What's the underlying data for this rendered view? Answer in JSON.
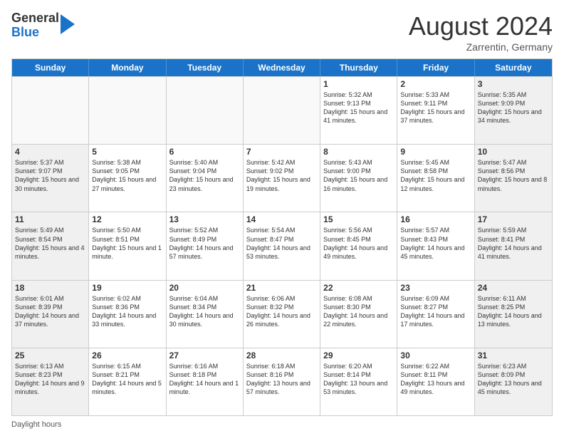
{
  "header": {
    "logo_general": "General",
    "logo_blue": "Blue",
    "month_title": "August 2024",
    "location": "Zarrentin, Germany"
  },
  "footer": {
    "daylight_label": "Daylight hours"
  },
  "days_of_week": [
    "Sunday",
    "Monday",
    "Tuesday",
    "Wednesday",
    "Thursday",
    "Friday",
    "Saturday"
  ],
  "rows": [
    [
      {
        "day": "",
        "text": "",
        "empty": true
      },
      {
        "day": "",
        "text": "",
        "empty": true
      },
      {
        "day": "",
        "text": "",
        "empty": true
      },
      {
        "day": "",
        "text": "",
        "empty": true
      },
      {
        "day": "1",
        "text": "Sunrise: 5:32 AM\nSunset: 9:13 PM\nDaylight: 15 hours\nand 41 minutes."
      },
      {
        "day": "2",
        "text": "Sunrise: 5:33 AM\nSunset: 9:11 PM\nDaylight: 15 hours\nand 37 minutes."
      },
      {
        "day": "3",
        "text": "Sunrise: 5:35 AM\nSunset: 9:09 PM\nDaylight: 15 hours\nand 34 minutes.",
        "shaded": true
      }
    ],
    [
      {
        "day": "4",
        "text": "Sunrise: 5:37 AM\nSunset: 9:07 PM\nDaylight: 15 hours\nand 30 minutes.",
        "shaded": true
      },
      {
        "day": "5",
        "text": "Sunrise: 5:38 AM\nSunset: 9:05 PM\nDaylight: 15 hours\nand 27 minutes."
      },
      {
        "day": "6",
        "text": "Sunrise: 5:40 AM\nSunset: 9:04 PM\nDaylight: 15 hours\nand 23 minutes."
      },
      {
        "day": "7",
        "text": "Sunrise: 5:42 AM\nSunset: 9:02 PM\nDaylight: 15 hours\nand 19 minutes."
      },
      {
        "day": "8",
        "text": "Sunrise: 5:43 AM\nSunset: 9:00 PM\nDaylight: 15 hours\nand 16 minutes."
      },
      {
        "day": "9",
        "text": "Sunrise: 5:45 AM\nSunset: 8:58 PM\nDaylight: 15 hours\nand 12 minutes."
      },
      {
        "day": "10",
        "text": "Sunrise: 5:47 AM\nSunset: 8:56 PM\nDaylight: 15 hours\nand 8 minutes.",
        "shaded": true
      }
    ],
    [
      {
        "day": "11",
        "text": "Sunrise: 5:49 AM\nSunset: 8:54 PM\nDaylight: 15 hours\nand 4 minutes.",
        "shaded": true
      },
      {
        "day": "12",
        "text": "Sunrise: 5:50 AM\nSunset: 8:51 PM\nDaylight: 15 hours\nand 1 minute."
      },
      {
        "day": "13",
        "text": "Sunrise: 5:52 AM\nSunset: 8:49 PM\nDaylight: 14 hours\nand 57 minutes."
      },
      {
        "day": "14",
        "text": "Sunrise: 5:54 AM\nSunset: 8:47 PM\nDaylight: 14 hours\nand 53 minutes."
      },
      {
        "day": "15",
        "text": "Sunrise: 5:56 AM\nSunset: 8:45 PM\nDaylight: 14 hours\nand 49 minutes."
      },
      {
        "day": "16",
        "text": "Sunrise: 5:57 AM\nSunset: 8:43 PM\nDaylight: 14 hours\nand 45 minutes."
      },
      {
        "day": "17",
        "text": "Sunrise: 5:59 AM\nSunset: 8:41 PM\nDaylight: 14 hours\nand 41 minutes.",
        "shaded": true
      }
    ],
    [
      {
        "day": "18",
        "text": "Sunrise: 6:01 AM\nSunset: 8:39 PM\nDaylight: 14 hours\nand 37 minutes.",
        "shaded": true
      },
      {
        "day": "19",
        "text": "Sunrise: 6:02 AM\nSunset: 8:36 PM\nDaylight: 14 hours\nand 33 minutes."
      },
      {
        "day": "20",
        "text": "Sunrise: 6:04 AM\nSunset: 8:34 PM\nDaylight: 14 hours\nand 30 minutes."
      },
      {
        "day": "21",
        "text": "Sunrise: 6:06 AM\nSunset: 8:32 PM\nDaylight: 14 hours\nand 26 minutes."
      },
      {
        "day": "22",
        "text": "Sunrise: 6:08 AM\nSunset: 8:30 PM\nDaylight: 14 hours\nand 22 minutes."
      },
      {
        "day": "23",
        "text": "Sunrise: 6:09 AM\nSunset: 8:27 PM\nDaylight: 14 hours\nand 17 minutes."
      },
      {
        "day": "24",
        "text": "Sunrise: 6:11 AM\nSunset: 8:25 PM\nDaylight: 14 hours\nand 13 minutes.",
        "shaded": true
      }
    ],
    [
      {
        "day": "25",
        "text": "Sunrise: 6:13 AM\nSunset: 8:23 PM\nDaylight: 14 hours\nand 9 minutes.",
        "shaded": true
      },
      {
        "day": "26",
        "text": "Sunrise: 6:15 AM\nSunset: 8:21 PM\nDaylight: 14 hours\nand 5 minutes."
      },
      {
        "day": "27",
        "text": "Sunrise: 6:16 AM\nSunset: 8:18 PM\nDaylight: 14 hours\nand 1 minute."
      },
      {
        "day": "28",
        "text": "Sunrise: 6:18 AM\nSunset: 8:16 PM\nDaylight: 13 hours\nand 57 minutes."
      },
      {
        "day": "29",
        "text": "Sunrise: 6:20 AM\nSunset: 8:14 PM\nDaylight: 13 hours\nand 53 minutes."
      },
      {
        "day": "30",
        "text": "Sunrise: 6:22 AM\nSunset: 8:11 PM\nDaylight: 13 hours\nand 49 minutes."
      },
      {
        "day": "31",
        "text": "Sunrise: 6:23 AM\nSunset: 8:09 PM\nDaylight: 13 hours\nand 45 minutes.",
        "shaded": true
      }
    ]
  ]
}
